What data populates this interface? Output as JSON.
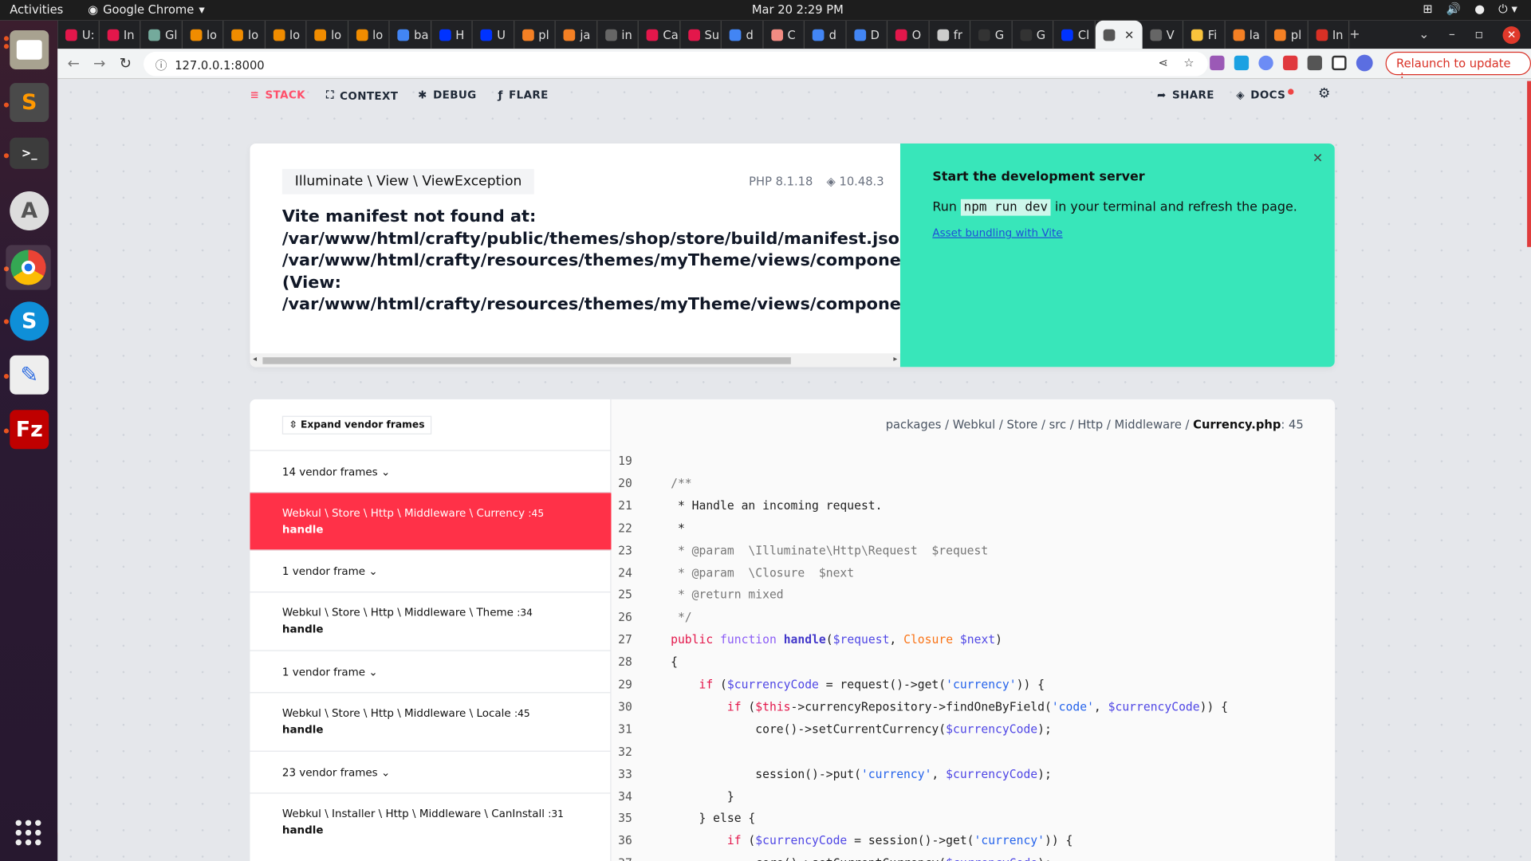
{
  "os": {
    "activities": "Activities",
    "app_name": "Google Chrome",
    "clock": "Mar 20  2:29 PM"
  },
  "dock": [
    "Files",
    "Sublime Text",
    "Terminal",
    "Software Updater",
    "Google Chrome",
    "Skype",
    "Text Editor",
    "FileZilla"
  ],
  "browser": {
    "tabs": [
      {
        "label": "U:",
        "color": "#e3174b"
      },
      {
        "label": "In",
        "color": "#e3174b"
      },
      {
        "label": "Gl",
        "color": "#74aa9c"
      },
      {
        "label": "lo",
        "color": "#f08c00"
      },
      {
        "label": "lo",
        "color": "#f08c00"
      },
      {
        "label": "lo",
        "color": "#f08c00"
      },
      {
        "label": "lo",
        "color": "#f08c00"
      },
      {
        "label": "lo",
        "color": "#f08c00"
      },
      {
        "label": "ba",
        "color": "#4285f4"
      },
      {
        "label": "H",
        "color": "#0033ff"
      },
      {
        "label": "U",
        "color": "#0033ff"
      },
      {
        "label": "pl",
        "color": "#f48024"
      },
      {
        "label": "ja",
        "color": "#f48024"
      },
      {
        "label": "in",
        "color": "#666"
      },
      {
        "label": "Ca",
        "color": "#e3174b"
      },
      {
        "label": "Su",
        "color": "#e3174b"
      },
      {
        "label": "d",
        "color": "#4285f4"
      },
      {
        "label": "C",
        "color": "#f28b82"
      },
      {
        "label": "d",
        "color": "#4285f4"
      },
      {
        "label": "D",
        "color": "#4285f4"
      },
      {
        "label": "O",
        "color": "#e3174b"
      },
      {
        "label": "fr",
        "color": "#ccc"
      },
      {
        "label": "G",
        "color": "#333"
      },
      {
        "label": "G",
        "color": "#333"
      },
      {
        "label": "Cl",
        "color": "#0033ff"
      },
      {
        "label": "",
        "color": "#555",
        "active": true
      },
      {
        "label": "V",
        "color": "#666"
      },
      {
        "label": "Fi",
        "color": "#f9c33c"
      },
      {
        "label": "la",
        "color": "#f48024"
      },
      {
        "label": "pl",
        "color": "#f48024"
      },
      {
        "label": "In",
        "color": "#d93025"
      }
    ],
    "url": "127.0.0.1:8000",
    "relaunch": "Relaunch to update"
  },
  "ignition": {
    "nav": {
      "stack": "STACK",
      "context": "CONTEXT",
      "debug": "DEBUG",
      "flare": "FLARE",
      "share": "SHARE",
      "docs": "DOCS"
    },
    "exception_class": "Illuminate \\ View \\ ViewException",
    "php_version": "PHP 8.1.18",
    "laravel_version": "10.48.3",
    "message": [
      "Vite manifest not found at:",
      "/var/www/html/crafty/public/themes/shop/store/build/manifest.json (View:",
      "/var/www/html/crafty/resources/themes/myTheme/views/components/layouts/index.blade.php)",
      "(View:",
      "/var/www/html/crafty/resources/themes/myTheme/views/components/layouts/index.blade.php)"
    ],
    "solution": {
      "title": "Start the development server",
      "text_before": "Run",
      "command": "npm run dev",
      "text_after": "in your terminal and refresh the page.",
      "link": "Asset bundling with Vite"
    },
    "expand_vendor": "Expand vendor frames",
    "frames": [
      {
        "type": "vendor",
        "label": "14 vendor frames"
      },
      {
        "type": "app",
        "class": "Webkul \\ Store \\ Http \\ Middleware \\ Currency",
        "line": ":45",
        "method": "handle",
        "selected": true
      },
      {
        "type": "vendor",
        "label": "1 vendor frame"
      },
      {
        "type": "app",
        "class": "Webkul \\ Store \\ Http \\ Middleware \\ Theme",
        "line": ":34",
        "method": "handle"
      },
      {
        "type": "vendor",
        "label": "1 vendor frame"
      },
      {
        "type": "app",
        "class": "Webkul \\ Store \\ Http \\ Middleware \\ Locale",
        "line": ":45",
        "method": "handle"
      },
      {
        "type": "vendor",
        "label": "23 vendor frames"
      },
      {
        "type": "app",
        "class": "Webkul \\ Installer \\ Http \\ Middleware \\ CanInstall",
        "line": ":31",
        "method": "handle"
      }
    ],
    "file_path": "packages / Webkul / Store / src / Http / Middleware / ",
    "file_name": "Currency.php",
    "file_line": ": 45",
    "code": [
      {
        "n": 19,
        "t": []
      },
      {
        "n": 20,
        "t": [
          [
            "    /**",
            "c"
          ]
        ]
      },
      {
        "n": 21,
        "t": [
          [
            "     * Handle an incoming request.",
            ""
          ]
        ]
      },
      {
        "n": 22,
        "t": [
          [
            "     *",
            ""
          ]
        ]
      },
      {
        "n": 23,
        "t": [
          [
            "     * @param  \\Illuminate\\Http\\Request  $request",
            "c"
          ]
        ]
      },
      {
        "n": 24,
        "t": [
          [
            "     * @param  \\Closure  $next",
            "c"
          ]
        ]
      },
      {
        "n": 25,
        "t": [
          [
            "     * @return mixed",
            "c"
          ]
        ]
      },
      {
        "n": 26,
        "t": [
          [
            "     */",
            "c"
          ]
        ]
      },
      {
        "n": 27,
        "t": [
          [
            "    ",
            ""
          ],
          [
            "public",
            "k"
          ],
          [
            " ",
            ""
          ],
          [
            "function",
            "f"
          ],
          [
            " ",
            ""
          ],
          [
            "handle",
            "n"
          ],
          [
            "(",
            ""
          ],
          [
            "$request",
            "v"
          ],
          [
            ", ",
            ""
          ],
          [
            "Closure",
            "t"
          ],
          [
            " ",
            ""
          ],
          [
            "$next",
            "v"
          ],
          [
            ")",
            ""
          ]
        ]
      },
      {
        "n": 28,
        "t": [
          [
            "    {",
            ""
          ]
        ]
      },
      {
        "n": 29,
        "t": [
          [
            "        ",
            ""
          ],
          [
            "if",
            "k"
          ],
          [
            " (",
            ""
          ],
          [
            "$currencyCode",
            "v"
          ],
          [
            " = request()->get(",
            ""
          ],
          [
            "'currency'",
            "s"
          ],
          [
            ")) {",
            ""
          ]
        ]
      },
      {
        "n": 30,
        "t": [
          [
            "            ",
            ""
          ],
          [
            "if",
            "k"
          ],
          [
            " (",
            ""
          ],
          [
            "$this",
            "k"
          ],
          [
            "->currencyRepository->findOneByField(",
            ""
          ],
          [
            "'code'",
            "s"
          ],
          [
            ", ",
            ""
          ],
          [
            "$currencyCode",
            "v"
          ],
          [
            ")) {",
            ""
          ]
        ]
      },
      {
        "n": 31,
        "t": [
          [
            "                core()->setCurrentCurrency(",
            ""
          ],
          [
            "$currencyCode",
            "v"
          ],
          [
            ");",
            ""
          ]
        ]
      },
      {
        "n": 32,
        "t": []
      },
      {
        "n": 33,
        "t": [
          [
            "                session()->put(",
            ""
          ],
          [
            "'currency'",
            "s"
          ],
          [
            ", ",
            ""
          ],
          [
            "$currencyCode",
            "v"
          ],
          [
            ");",
            ""
          ]
        ]
      },
      {
        "n": 34,
        "t": [
          [
            "            }",
            ""
          ]
        ]
      },
      {
        "n": 35,
        "t": [
          [
            "        } else {",
            ""
          ]
        ]
      },
      {
        "n": 36,
        "t": [
          [
            "            ",
            ""
          ],
          [
            "if",
            "k"
          ],
          [
            " (",
            ""
          ],
          [
            "$currencyCode",
            "v"
          ],
          [
            " = session()->get(",
            ""
          ],
          [
            "'currency'",
            "s"
          ],
          [
            ")) {",
            ""
          ]
        ]
      },
      {
        "n": 37,
        "t": [
          [
            "                core()->setCurrentCurrency(",
            ""
          ],
          [
            "$currencyCode",
            "v"
          ],
          [
            ");",
            ""
          ]
        ]
      }
    ]
  }
}
